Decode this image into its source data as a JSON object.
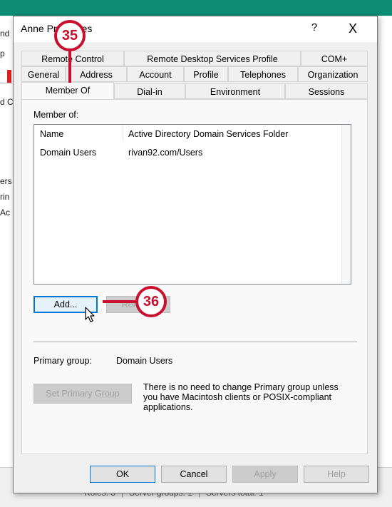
{
  "background": {
    "fragments": [
      "nd",
      "p",
      "d C",
      "ers",
      "rin",
      "Ac"
    ],
    "status": {
      "roles": "Roles: 5",
      "groups": "Server groups: 1",
      "servers": "Servers total: 1"
    }
  },
  "dialog": {
    "title": "Anne      Properties",
    "help": "?",
    "close": "X",
    "tabs_row1": [
      "Remote Control",
      "Remote Desktop Services Profile",
      "COM+"
    ],
    "tabs_row2": [
      "General",
      "Address",
      "Account",
      "Profile",
      "Telephones",
      "Organization"
    ],
    "tabs_row3": [
      "Member Of",
      "Dial-in",
      "Environment",
      "Sessions"
    ],
    "member_of_label": "Member of:",
    "list_headers": {
      "name": "Name",
      "folder": "Active Directory Domain Services Folder"
    },
    "rows": [
      {
        "name": "Domain Users",
        "folder": "rivan92.com/Users"
      }
    ],
    "add_button": "Add...",
    "remove_button": "Remove",
    "primary_group_label": "Primary group:",
    "primary_group_value": "Domain Users",
    "set_primary_button": "Set Primary Group",
    "info_text_1": "There is no need to change Primary group unless",
    "info_text_2": "you have Macintosh clients or POSIX-compliant",
    "info_text_3": "applications.",
    "ok": "OK",
    "cancel": "Cancel",
    "apply": "Apply",
    "help_button": "Help"
  },
  "callouts": {
    "step1": "35",
    "step2": "36"
  },
  "colors": {
    "accent": "#0f8c74",
    "callout": "#c8102e",
    "focus": "#0078d7"
  }
}
